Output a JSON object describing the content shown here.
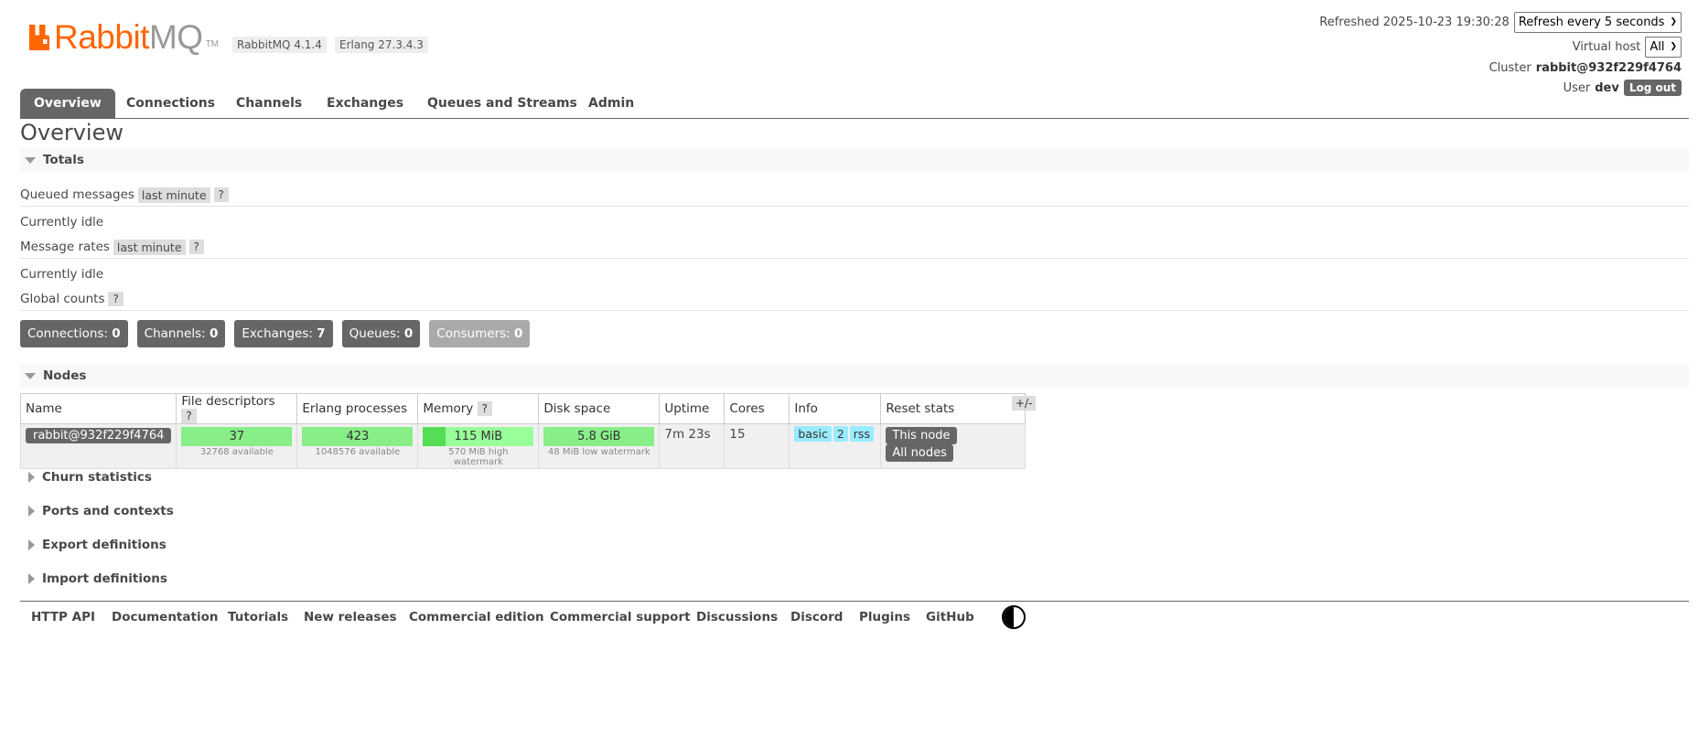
{
  "header": {
    "logo_main": "Rabbit",
    "logo_mq": "MQ",
    "logo_tm": "TM",
    "rabbitmq_version": "RabbitMQ 4.1.4",
    "erlang_version": "Erlang 27.3.4.3",
    "refreshed_label": "Refreshed 2025-10-23 19:30:28",
    "refresh_select": "Refresh every 5 seconds",
    "virtual_host_label": "Virtual host",
    "virtual_host_value": "All",
    "cluster_label": "Cluster",
    "cluster_name": "rabbit@932f229f4764",
    "user_label": "User",
    "user_name": "dev",
    "logout": "Log out",
    "accent": "#ff6600"
  },
  "tabs": [
    "Overview",
    "Connections",
    "Channels",
    "Exchanges",
    "Queues and Streams",
    "Admin"
  ],
  "page_title": "Overview",
  "totals": {
    "title": "Totals",
    "queued_label": "Queued messages",
    "queued_range": "last minute",
    "help": "?",
    "idle1": "Currently idle",
    "rates_label": "Message rates",
    "rates_range": "last minute",
    "idle2": "Currently idle",
    "global_label": "Global counts"
  },
  "counts": {
    "connections_label": "Connections:",
    "connections": "0",
    "channels_label": "Channels:",
    "channels": "0",
    "exchanges_label": "Exchanges:",
    "exchanges": "7",
    "queues_label": "Queues:",
    "queues": "0",
    "consumers_label": "Consumers:",
    "consumers": "0"
  },
  "nodes": {
    "title": "Nodes",
    "columns": [
      "Name",
      "File descriptors",
      "Erlang processes",
      "Memory",
      "Disk space",
      "Uptime",
      "Cores",
      "Info",
      "Reset stats"
    ],
    "toggle": "+/-",
    "row": {
      "name": "rabbit@932f229f4764",
      "fd": "37",
      "fd_sub": "32768 available",
      "proc": "423",
      "proc_sub": "1048576 available",
      "mem": "115 MiB",
      "mem_sub": "570 MiB high watermark",
      "mem_fraction": 0.2,
      "disk": "5.8 GiB",
      "disk_sub": "48 MiB low watermark",
      "uptime": "7m 23s",
      "cores": "15",
      "info_basic": "basic",
      "info_2": "2",
      "info_rss": "rss",
      "this_node": "This node",
      "all_nodes": "All nodes"
    }
  },
  "collapsed_sections": [
    "Churn statistics",
    "Ports and contexts",
    "Export definitions",
    "Import definitions"
  ],
  "footer": [
    "HTTP API",
    "Documentation",
    "Tutorials",
    "New releases",
    "Commercial edition",
    "Commercial support",
    "Discussions",
    "Discord",
    "Plugins",
    "GitHub"
  ]
}
